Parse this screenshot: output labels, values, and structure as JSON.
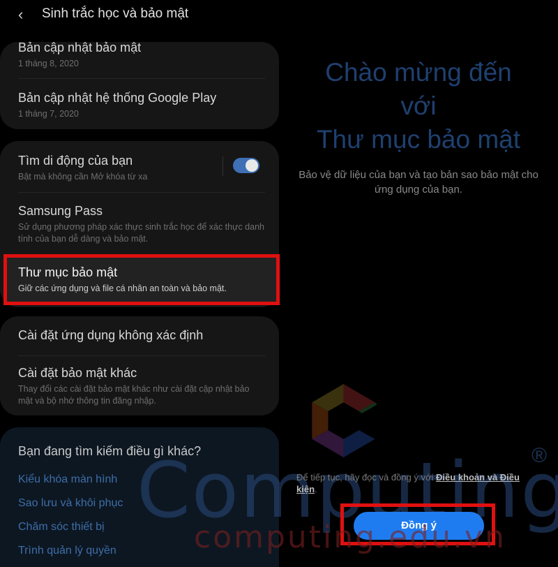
{
  "header": {
    "title": "Sinh trắc học và bảo mật",
    "back_icon": "back-chevron-icon"
  },
  "updates": [
    {
      "title": "Bản cập nhật bảo mật",
      "date": "1 tháng 8, 2020"
    },
    {
      "title": "Bản cập nhật hệ thống Google Play",
      "date": "1 tháng 7, 2020"
    }
  ],
  "security_items": [
    {
      "title": "Tìm di động của bạn",
      "subtitle": "Bật mà không cần Mở khóa từ xa",
      "toggle_on": true
    },
    {
      "title": "Samsung Pass",
      "subtitle": "Sử dụng phương pháp xác thực sinh trắc học để xác thực danh tính của bạn dễ dàng và bảo mật."
    },
    {
      "title": "Thư mục bảo mật",
      "subtitle": "Giữ các ứng dụng và file cá nhân an toàn và bảo mật."
    }
  ],
  "other_items": [
    {
      "title": "Cài đặt ứng dụng không xác định"
    },
    {
      "title": "Cài đặt bảo mật khác",
      "subtitle": "Thay đổi các cài đặt bảo mật khác như cài đặt cập nhật bảo mật và bộ nhớ thông tin đăng nhập."
    }
  ],
  "search_card": {
    "title": "Bạn đang tìm kiếm điều gì khác?",
    "links": [
      "Kiểu khóa màn hình",
      "Sao lưu và khôi phục",
      "Chăm sóc thiết bị",
      "Trình quản lý quyền"
    ]
  },
  "welcome": {
    "title_lines": [
      "Chào mừng đến",
      "với",
      "Thư mục bảo mật"
    ],
    "description": "Bảo vệ dữ liệu của bạn và tạo bản sao bảo mật cho ứng dụng của bạn.",
    "terms_prefix": "Để tiếp tục, hãy đọc và đồng ý với ",
    "terms_link": "Điều khoản và Điều kiện",
    "terms_suffix": ".",
    "agree_button": "Đồng ý"
  },
  "watermark": {
    "brand": "Computing",
    "registered": "®",
    "url": "computing.edu.vn"
  },
  "colors": {
    "toggle": "#3f6fb4",
    "highlight": "#e01010",
    "button": "#1f7cf0",
    "link": "#3d6ea8"
  }
}
